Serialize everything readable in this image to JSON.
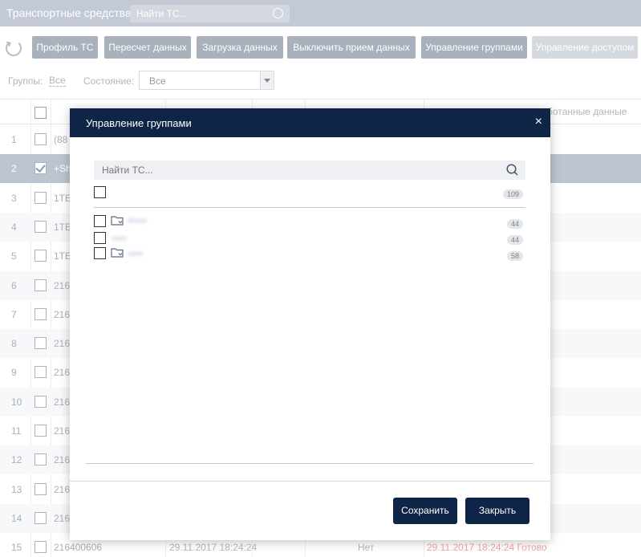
{
  "header": {
    "title": "Транспортные средства",
    "search_placeholder": "Найти ТС..."
  },
  "toolbar": {
    "buttons": [
      {
        "label": "Профиль ТС"
      },
      {
        "label": "Пересчет данных"
      },
      {
        "label": "Загрузка данных"
      },
      {
        "label": "Выключить прием данных"
      },
      {
        "label": "Управление группами"
      },
      {
        "label": "Управление доступом"
      }
    ]
  },
  "filters": {
    "groups_label": "Группы:",
    "groups_value": "Все",
    "state_label": "Состояние:",
    "state_value": "Все"
  },
  "table": {
    "header_partial": "ботанные данные",
    "rows": [
      {
        "num": "1",
        "name": "(88",
        "date1": "",
        "flag": "",
        "date2": ""
      },
      {
        "num": "2",
        "name": "+Sh",
        "date1": "",
        "flag": "",
        "date2": ""
      },
      {
        "num": "3",
        "name": "1TE",
        "date1": "",
        "flag": "",
        "date2": ""
      },
      {
        "num": "4",
        "name": "1TE",
        "date1": "",
        "flag": "",
        "date2": ""
      },
      {
        "num": "5",
        "name": "1TE",
        "date1": "",
        "flag": "",
        "date2": ""
      },
      {
        "num": "6",
        "name": "216",
        "date1": "",
        "flag": "",
        "date2": ""
      },
      {
        "num": "7",
        "name": "216",
        "date1": "",
        "flag": "",
        "date2": ""
      },
      {
        "num": "8",
        "name": "216",
        "date1": "",
        "flag": "",
        "date2": ""
      },
      {
        "num": "9",
        "name": "216",
        "date1": "",
        "flag": "",
        "date2": ""
      },
      {
        "num": "10",
        "name": "216",
        "date1": "",
        "flag": "",
        "date2": ""
      },
      {
        "num": "11",
        "name": "216",
        "date1": "",
        "flag": "",
        "date2": ""
      },
      {
        "num": "12",
        "name": "216",
        "date1": "",
        "flag": "",
        "date2": ""
      },
      {
        "num": "13",
        "name": "216",
        "date1": "",
        "flag": "",
        "date2": ""
      },
      {
        "num": "14",
        "name": "216",
        "date1": "",
        "flag": "",
        "date2": ""
      },
      {
        "num": "15",
        "name": "216400606",
        "date1": "29.11.2017 18:24:24",
        "flag": "Нет",
        "date2": "29.11.2017 18:24:24 Готово"
      }
    ]
  },
  "modal": {
    "title": "Управление группами",
    "close_glyph": "×",
    "search_placeholder": "Найти ТС...",
    "all_count": "109",
    "groups": [
      {
        "name": "driver",
        "count": "44"
      },
      {
        "name": "user",
        "count": "44"
      },
      {
        "name": "user",
        "count": "58"
      }
    ],
    "save_label": "Сохранить",
    "close_label": "Закрыть"
  }
}
